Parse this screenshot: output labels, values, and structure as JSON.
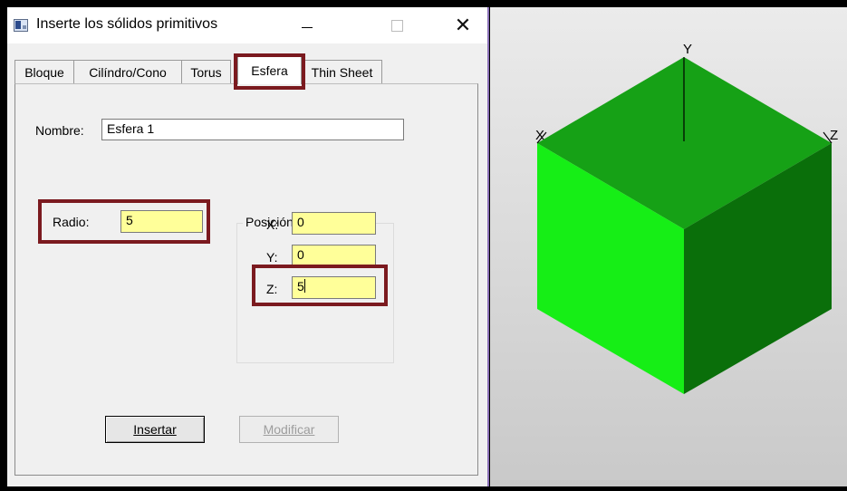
{
  "window": {
    "title": "Inserte los sólidos primitivos",
    "icon": "app-window-icon",
    "close_glyph": "✕"
  },
  "tabs": [
    {
      "label": "Bloque",
      "active": false
    },
    {
      "label": "Cilíndro/Cono",
      "active": false
    },
    {
      "label": "Torus",
      "active": false
    },
    {
      "label": "Esfera",
      "active": true
    },
    {
      "label": "Thin Sheet",
      "active": false
    }
  ],
  "form": {
    "name_label": "Nombre:",
    "name_value": "Esfera 1",
    "radius_label": "Radio:",
    "radius_value": "5",
    "center_group_title": "Posición de centro",
    "x_label": "X:",
    "x_value": "0",
    "y_label": "Y:",
    "y_value": "0",
    "z_label": "Z:",
    "z_value": "5"
  },
  "buttons": {
    "insert": "Insertar",
    "modify": "Modificar"
  },
  "viewport": {
    "axis_x": "X",
    "axis_y": "Y",
    "axis_z": "Z",
    "colors": {
      "top": "#16a116",
      "left": "#16ee16",
      "right": "#0a6f0a",
      "highlight": "#7b1a1f"
    }
  }
}
